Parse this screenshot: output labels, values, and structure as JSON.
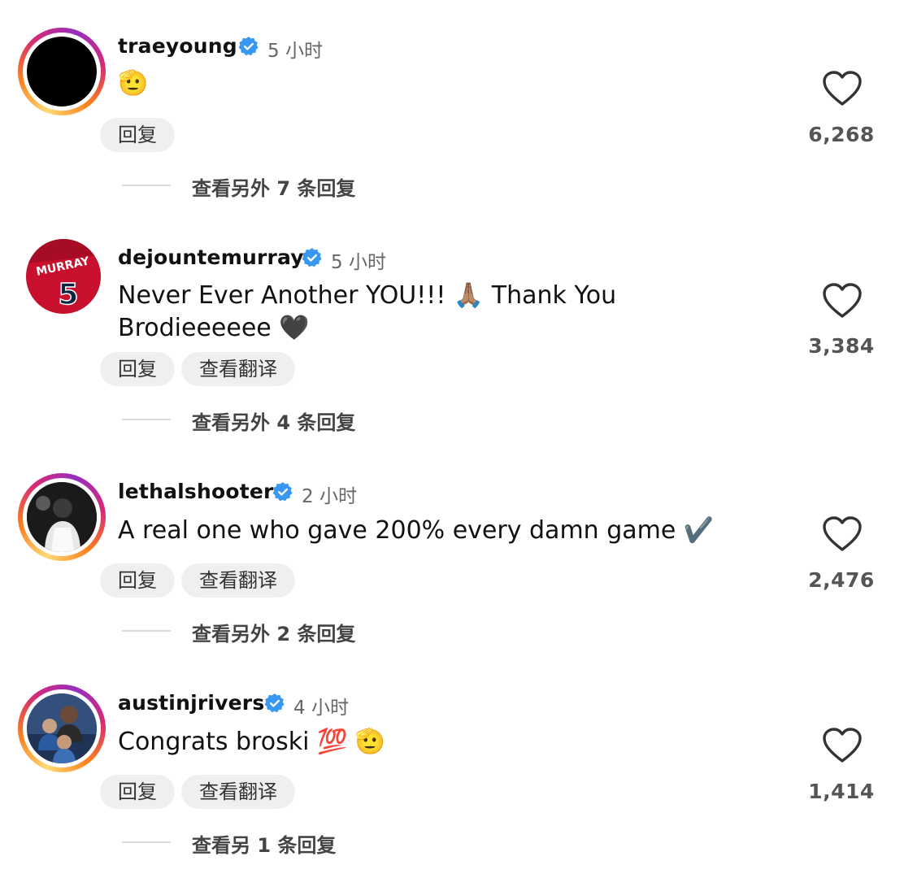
{
  "comments": [
    {
      "username": "traeyoung",
      "time": "5 小时",
      "text": "🫡",
      "reply_label": "回复",
      "translate_label": null,
      "likes": "6,268",
      "more_replies": "查看另外 7 条回复"
    },
    {
      "username": "dejountemurray",
      "time": "5 小时",
      "text_line1": "Never Ever Another YOU!!! 🙏🏽 Thank You",
      "text_line2": "Brodieeeeee 🖤",
      "reply_label": "回复",
      "translate_label": "查看翻译",
      "likes": "3,384",
      "more_replies": "查看另外 4 条回复",
      "jersey_name": "MURRAY",
      "jersey_number": "5"
    },
    {
      "username": "lethalshooter",
      "time": "2 小时",
      "text": "A real one who gave 200% every damn game ✔️",
      "reply_label": "回复",
      "translate_label": "查看翻译",
      "likes": "2,476",
      "more_replies": "查看另外 2 条回复"
    },
    {
      "username": "austinjrivers",
      "time": "4 小时",
      "text": "Congrats broski 💯 🫡",
      "reply_label": "回复",
      "translate_label": "查看翻译",
      "likes": "1,414",
      "more_replies": "查看另 1 条回复"
    }
  ],
  "colors": {
    "verified_badge": "#3897f0",
    "pill_bg": "#efefef",
    "muted_text": "#666666"
  },
  "icons": {
    "verified": "verified-badge-icon",
    "like": "heart-outline-icon"
  }
}
